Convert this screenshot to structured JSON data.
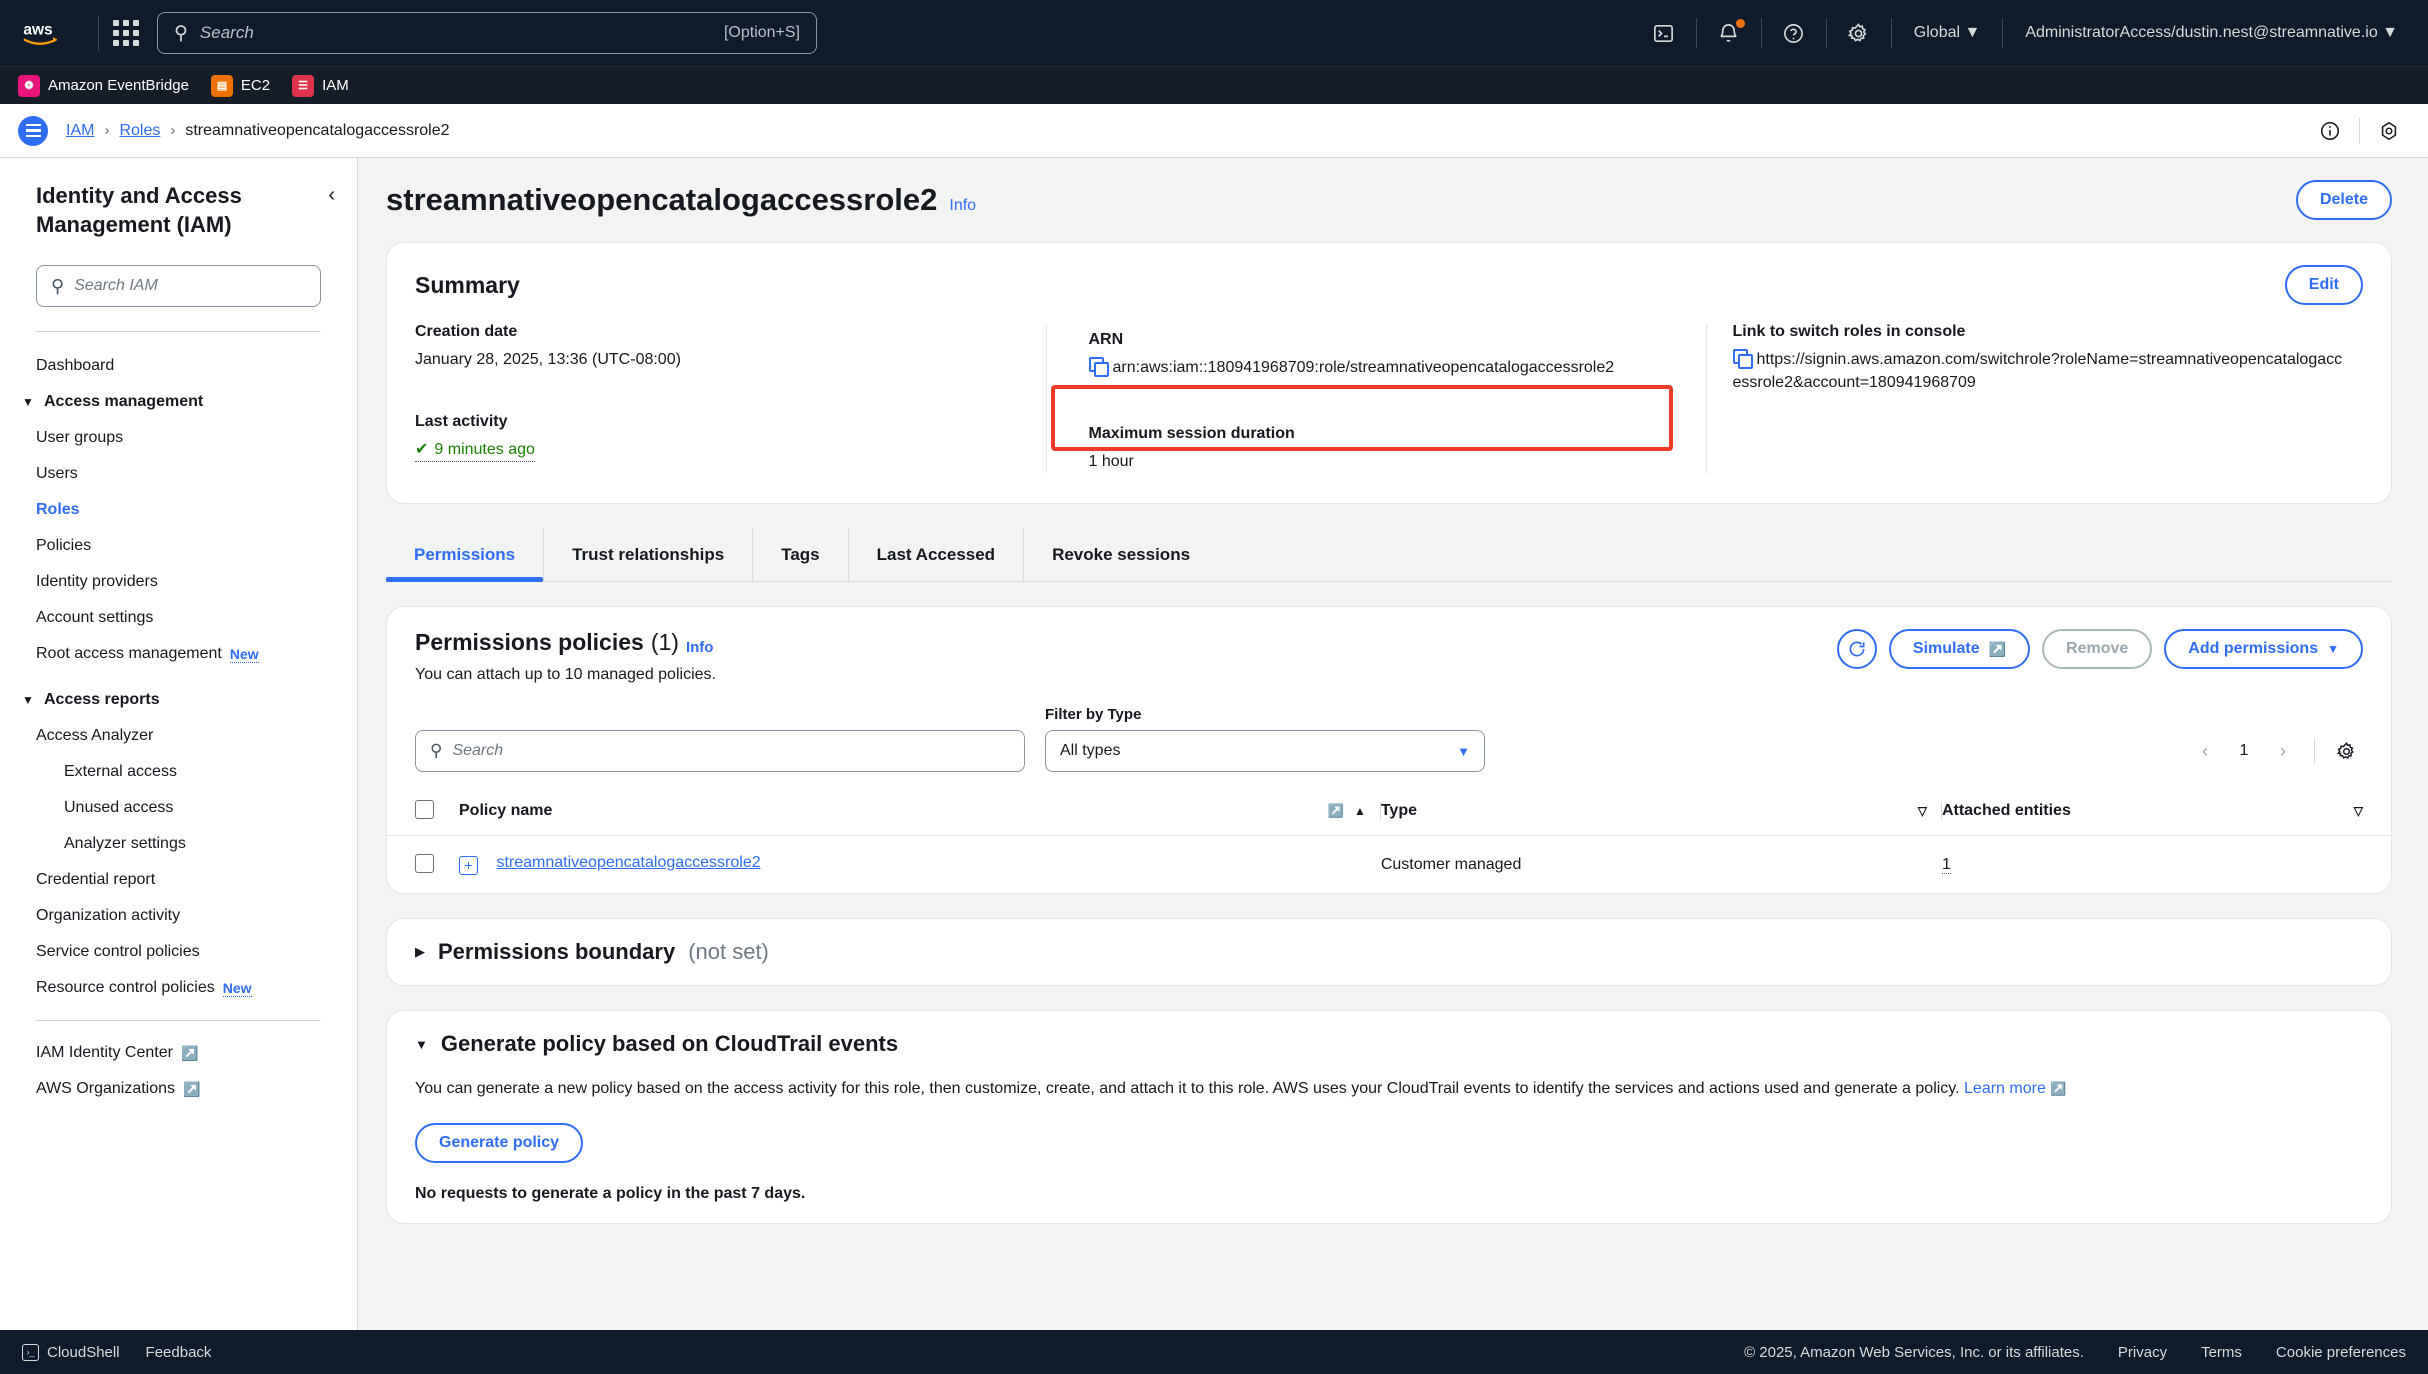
{
  "topnav": {
    "logo": "aws-logo",
    "search_placeholder": "Search",
    "search_shortcut": "[Option+S]",
    "region_label": "Global",
    "account_label": "AdministratorAccess/dustin.nest@streamnative.io",
    "icons": [
      "cloudshell-icon",
      "bell-icon",
      "help-icon",
      "settings-icon"
    ]
  },
  "servicebar": {
    "items": [
      {
        "label": "Amazon EventBridge",
        "color": "#e7157b",
        "glyph": "❁"
      },
      {
        "label": "EC2",
        "color": "#ed7100",
        "glyph": "◱"
      },
      {
        "label": "IAM",
        "color": "#dd344c",
        "glyph": "☰"
      }
    ]
  },
  "breadcrumb": {
    "items": [
      "IAM",
      "Roles",
      "streamnativeopencatalogaccessrole2"
    ],
    "separator": "›"
  },
  "sidebar": {
    "title": "Identity and Access Management (IAM)",
    "search_placeholder": "Search IAM",
    "items": [
      {
        "label": "Dashboard",
        "type": "item"
      },
      {
        "label": "Access management",
        "type": "group"
      },
      {
        "label": "User groups",
        "type": "item"
      },
      {
        "label": "Users",
        "type": "item"
      },
      {
        "label": "Roles",
        "type": "item",
        "active": true
      },
      {
        "label": "Policies",
        "type": "item"
      },
      {
        "label": "Identity providers",
        "type": "item"
      },
      {
        "label": "Account settings",
        "type": "item"
      },
      {
        "label": "Root access management",
        "type": "item",
        "badge": "New"
      },
      {
        "label": "Access reports",
        "type": "group"
      },
      {
        "label": "Access Analyzer",
        "type": "item"
      },
      {
        "label": "External access",
        "type": "subitem"
      },
      {
        "label": "Unused access",
        "type": "subitem"
      },
      {
        "label": "Analyzer settings",
        "type": "subitem"
      },
      {
        "label": "Credential report",
        "type": "item"
      },
      {
        "label": "Organization activity",
        "type": "item"
      },
      {
        "label": "Service control policies",
        "type": "item"
      },
      {
        "label": "Resource control policies",
        "type": "item",
        "badge": "New"
      }
    ],
    "footer_items": [
      {
        "label": "IAM Identity Center",
        "external": true
      },
      {
        "label": "AWS Organizations",
        "external": true
      }
    ]
  },
  "page": {
    "title": "streamnativeopencatalogaccessrole2",
    "info_label": "Info",
    "delete_label": "Delete"
  },
  "summary": {
    "title": "Summary",
    "edit_label": "Edit",
    "creation_date_label": "Creation date",
    "creation_date_value": "January 28, 2025, 13:36 (UTC-08:00)",
    "last_activity_label": "Last activity",
    "last_activity_value": "9 minutes ago",
    "arn_label": "ARN",
    "arn_value": "arn:aws:iam::180941968709:role/streamnativeopencatalogaccessrole2",
    "arn_highlight_color": "#ee3b26",
    "max_session_label": "Maximum session duration",
    "max_session_value": "1 hour",
    "switch_link_label": "Link to switch roles in console",
    "switch_link_value": "https://signin.aws.amazon.com/switchrole?roleName=streamnativeopencatalogaccessrole2&account=180941968709"
  },
  "tabs": [
    {
      "label": "Permissions",
      "active": true
    },
    {
      "label": "Trust relationships",
      "active": false
    },
    {
      "label": "Tags",
      "active": false
    },
    {
      "label": "Last Accessed",
      "active": false
    },
    {
      "label": "Revoke sessions",
      "active": false
    }
  ],
  "policies": {
    "title": "Permissions policies",
    "count": "(1)",
    "info_label": "Info",
    "subtitle": "You can attach up to 10 managed policies.",
    "refresh_label": "refresh-icon",
    "simulate_label": "Simulate",
    "remove_label": "Remove",
    "add_permissions_label": "Add permissions",
    "search_placeholder": "Search",
    "filter_label": "Filter by Type",
    "filter_value": "All types",
    "page_number": "1",
    "columns": [
      "Policy name",
      "Type",
      "Attached entities"
    ],
    "rows": [
      {
        "name": "streamnativeopencatalogaccessrole2",
        "type": "Customer managed",
        "attached_entities": "1"
      }
    ]
  },
  "permissions_boundary": {
    "title": "Permissions boundary",
    "note": "(not set)",
    "expanded": false
  },
  "generate_policy": {
    "title": "Generate policy based on CloudTrail events",
    "expanded": true,
    "description": "You can generate a new policy based on the access activity for this role, then customize, create, and attach it to this role. AWS uses your CloudTrail events to identify the services and actions used and generate a policy.",
    "learn_more_label": "Learn more",
    "button_label": "Generate policy",
    "status": "No requests to generate a policy in the past 7 days."
  },
  "footer": {
    "cloudshell_label": "CloudShell",
    "feedback_label": "Feedback",
    "copyright": "© 2025, Amazon Web Services, Inc. or its affiliates.",
    "links": [
      "Privacy",
      "Terms",
      "Cookie preferences"
    ]
  }
}
